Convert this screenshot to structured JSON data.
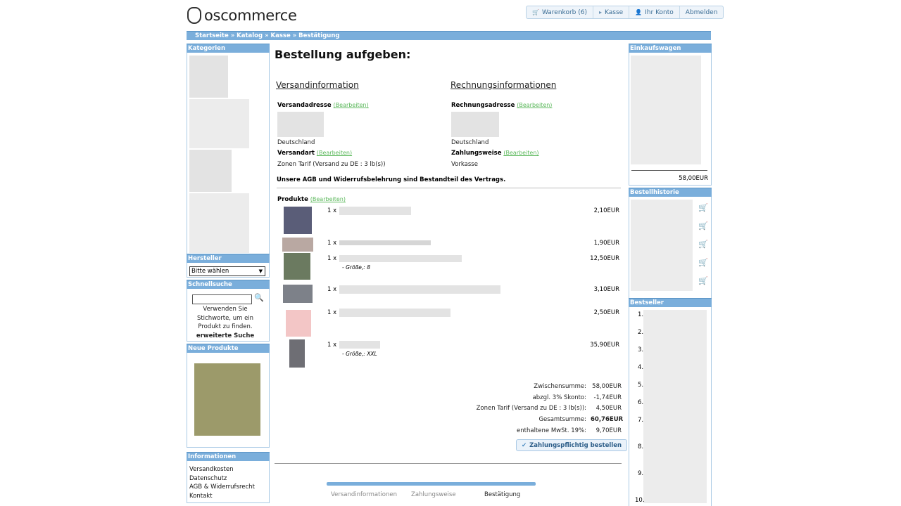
{
  "header": {
    "logo_text": "oscommerce",
    "nav": [
      {
        "label": "Warenkorb (6)",
        "icon": "cart-icon"
      },
      {
        "label": "Kasse",
        "icon": "arrow-icon"
      },
      {
        "label": "Ihr Konto",
        "icon": "user-icon"
      },
      {
        "label": "Abmelden",
        "icon": ""
      }
    ]
  },
  "breadcrumb": "Startseite » Katalog » Kasse » Bestätigung",
  "left": {
    "categories_title": "Kategorien",
    "manufacturers_title": "Hersteller",
    "manufacturers_select": "Bitte wählen",
    "quicksearch_title": "Schnellsuche",
    "quicksearch_text": "Verwenden Sie Stichworte, um ein Produkt zu finden.",
    "advanced_search": "erweiterte Suche",
    "new_products_title": "Neue Produkte",
    "info_title": "Informationen",
    "info_links": [
      "Versandkosten",
      "Datenschutz",
      "AGB & Widerrufsrecht",
      "Kontakt"
    ]
  },
  "right": {
    "cart_title": "Einkaufswagen",
    "cart_total": "58,00EUR",
    "history_title": "Bestellhistorie",
    "bestseller_title": "Bestseller",
    "bestseller_numbers": [
      "1.",
      "2.",
      "3.",
      "4.",
      "5.",
      "6.",
      "7.",
      "8.",
      "9.",
      "10."
    ]
  },
  "main": {
    "title": "Bestellung aufgeben:",
    "shipping_title": "Versandinformation",
    "billing_title": "Rechnungsinformationen",
    "shipping_address_label": "Versandadresse",
    "billing_address_label": "Rechnungsadresse",
    "edit": "(Bearbeiten)",
    "country_ship": "Deutschland",
    "country_bill": "Deutschland",
    "shipping_method_label": "Versandart",
    "shipping_method": "Zonen Tarif (Versand zu DE : 3 lb(s))",
    "payment_label": "Zahlungsweise",
    "payment_method": "Vorkasse",
    "terms": "Unsere AGB und Widerrufsbelehrung sind Bestandteil des Vertrags.",
    "products_label": "Produkte",
    "products": [
      {
        "qty": "1 x",
        "price": "2,10EUR",
        "attr": ""
      },
      {
        "qty": "1 x",
        "price": "1,90EUR",
        "attr": ""
      },
      {
        "qty": "1 x",
        "price": "12,50EUR",
        "attr": "- Größe,: 8"
      },
      {
        "qty": "1 x",
        "price": "3,10EUR",
        "attr": ""
      },
      {
        "qty": "1 x",
        "price": "2,50EUR",
        "attr": ""
      },
      {
        "qty": "1 x",
        "price": "35,90EUR",
        "attr": "- Größe,: XXL"
      }
    ],
    "totals": [
      {
        "label": "Zwischensumme:",
        "value": "58,00EUR",
        "bold": false
      },
      {
        "label": "abzgl. 3% Skonto:",
        "value": "-1,74EUR",
        "bold": false
      },
      {
        "label": "Zonen Tarif (Versand zu DE : 3 lb(s)):",
        "value": "4,50EUR",
        "bold": false
      },
      {
        "label": "Gesamtsumme:",
        "value": "60,76EUR",
        "bold": true
      },
      {
        "label": "enthaltene MwSt. 19%:",
        "value": "9,70EUR",
        "bold": false
      }
    ],
    "order_button": "Zahlungspflichtig bestellen",
    "steps": [
      "Versandinformationen",
      "Zahlungsweise",
      "Bestätigung"
    ]
  }
}
